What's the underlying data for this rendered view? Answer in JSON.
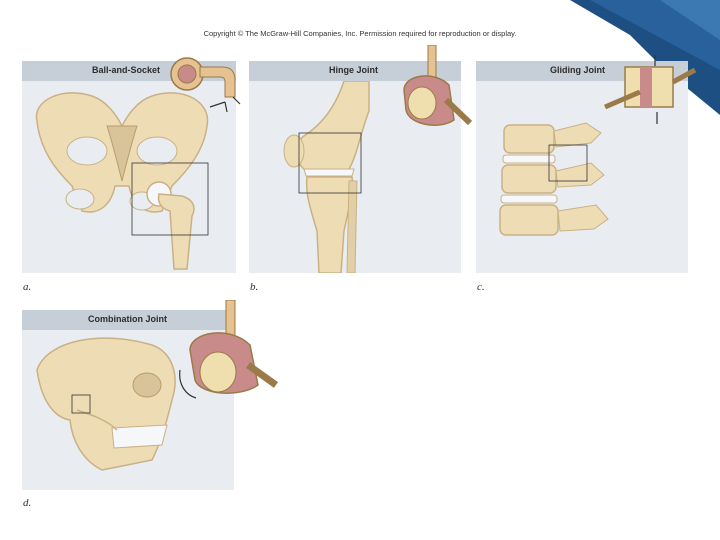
{
  "copyright": "Copyright © The McGraw-Hill Companies, Inc. Permission required for reproduction or display.",
  "colors": {
    "bone": "#eedcb5",
    "bone_shade": "#c9b185",
    "cartilage": "#f5f7fb",
    "panel_bg": "#e9edf1",
    "panel_header": "#c6cfd7",
    "corner_blue": "#1d4f82",
    "joint_inner": "#c98a8a"
  },
  "panels": [
    {
      "title": "Ball-and-Socket",
      "letter": "a."
    },
    {
      "title": "Hinge Joint",
      "letter": "b."
    },
    {
      "title": "Gliding Joint",
      "letter": "c."
    },
    {
      "title": "Combination Joint",
      "letter": "d."
    }
  ]
}
